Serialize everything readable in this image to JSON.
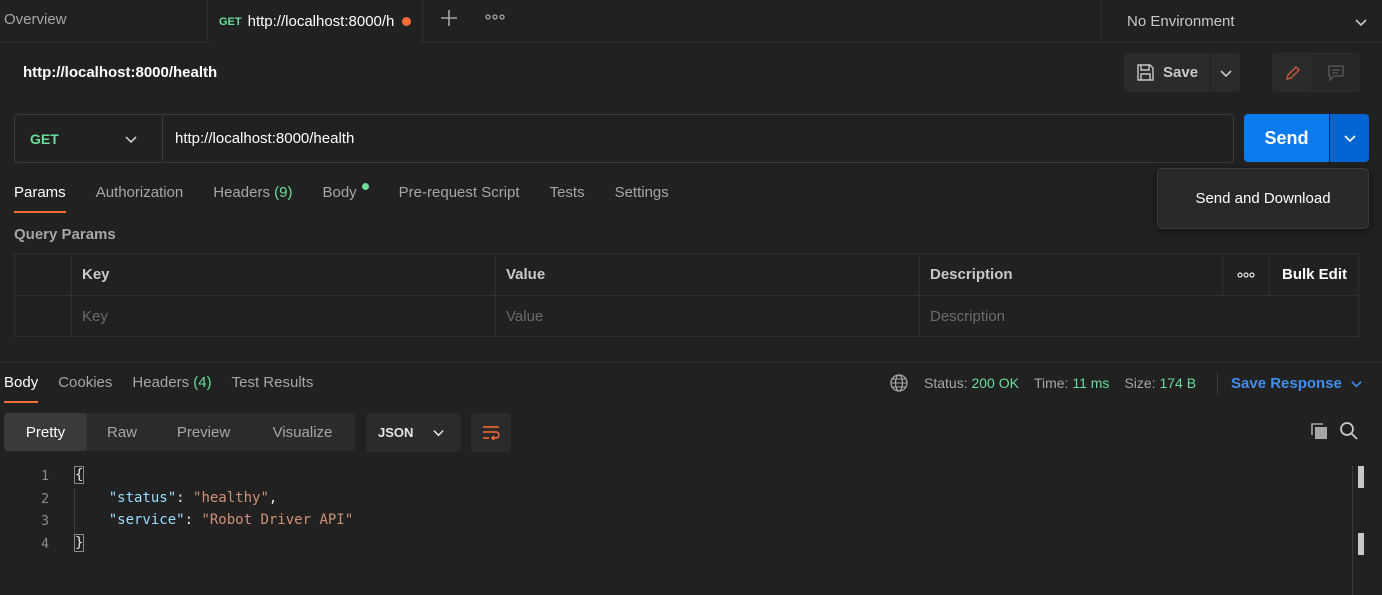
{
  "tabs": {
    "overview": "Overview",
    "active_method": "GET",
    "active_url": "http://localhost:8000/h",
    "environment": "No Environment"
  },
  "request": {
    "title": "http://localhost:8000/health",
    "save_label": "Save",
    "method": "GET",
    "url": "http://localhost:8000/health",
    "send_label": "Send",
    "send_menu_item": "Send and Download"
  },
  "request_tabs": {
    "params": "Params",
    "authorization": "Authorization",
    "headers": "Headers",
    "headers_count": "(9)",
    "body": "Body",
    "pre_request": "Pre-request Script",
    "tests": "Tests",
    "settings": "Settings"
  },
  "query_params": {
    "title": "Query Params",
    "columns": {
      "key": "Key",
      "value": "Value",
      "description": "Description",
      "bulk_edit": "Bulk Edit"
    },
    "placeholders": {
      "key": "Key",
      "value": "Value",
      "description": "Description"
    }
  },
  "response": {
    "tabs": {
      "body": "Body",
      "cookies": "Cookies",
      "headers": "Headers",
      "headers_count": "(4)",
      "test_results": "Test Results"
    },
    "status_label": "Status:",
    "status_value": "200 OK",
    "time_label": "Time:",
    "time_value": "11 ms",
    "size_label": "Size:",
    "size_value": "174 B",
    "save_response": "Save Response",
    "views": [
      "Pretty",
      "Raw",
      "Preview",
      "Visualize"
    ],
    "format": "JSON",
    "line_numbers": [
      "1",
      "2",
      "3",
      "4"
    ],
    "code": {
      "open": "{",
      "k1": "\"status\"",
      "v1": "\"healthy\"",
      "k2": "\"service\"",
      "v2": "\"Robot Driver API\"",
      "close": "}"
    }
  },
  "colors": {
    "accent_orange": "#ff6c37",
    "send_blue": "#097bed",
    "method_green": "#6bdd9a",
    "link_blue": "#3f8ef2"
  }
}
